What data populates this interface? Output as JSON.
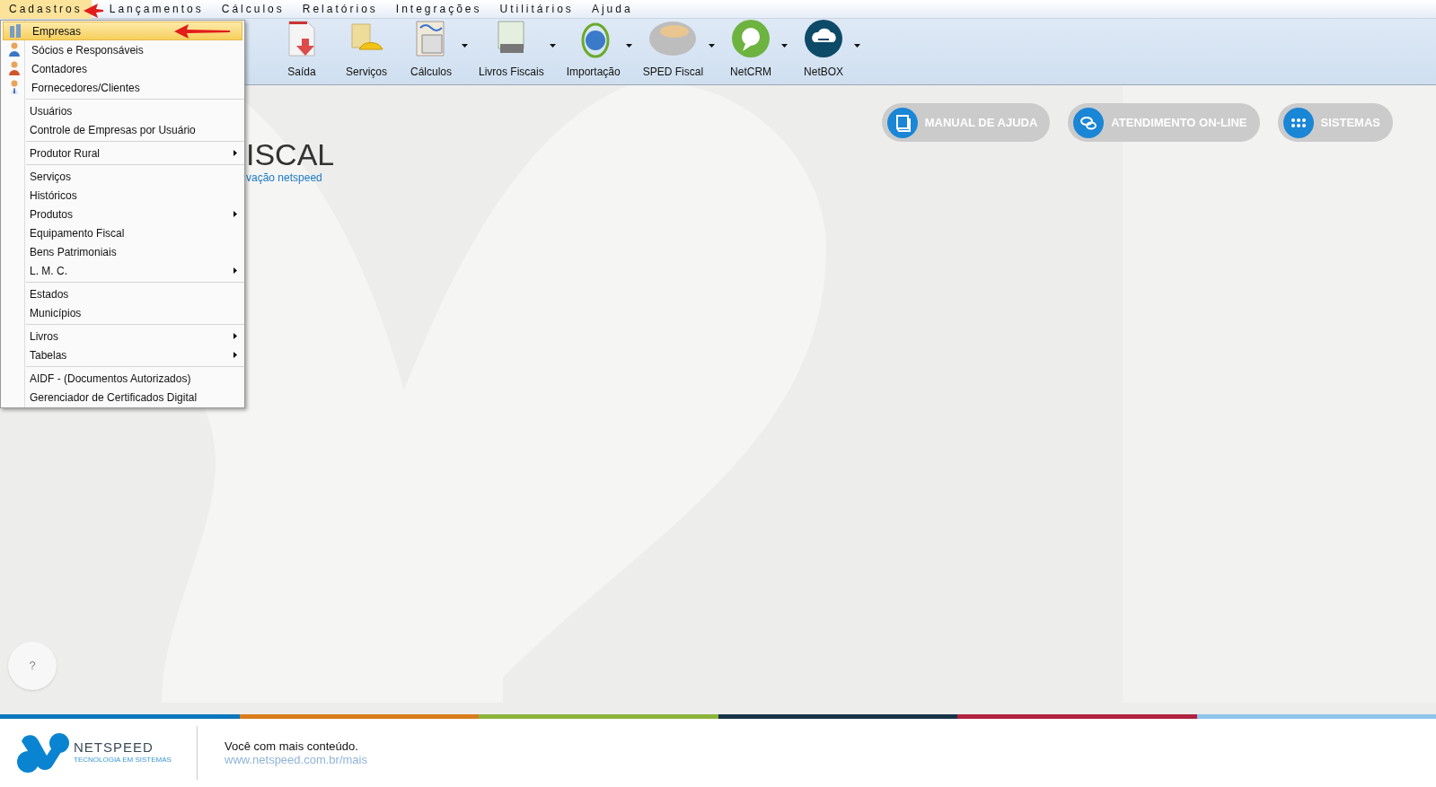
{
  "menubar": [
    {
      "label": "Cadastros",
      "selected": true
    },
    {
      "label": "Lançamentos",
      "selected": false
    },
    {
      "label": "Cálculos",
      "selected": false
    },
    {
      "label": "Relatórios",
      "selected": false
    },
    {
      "label": "Integrações",
      "selected": false
    },
    {
      "label": "Utilitários",
      "selected": false
    },
    {
      "label": "Ajuda",
      "selected": false
    }
  ],
  "toolbar": [
    {
      "label": "Saída",
      "dropdown": false
    },
    {
      "label": "Serviços",
      "dropdown": false
    },
    {
      "label": "Cálculos",
      "dropdown": true
    },
    {
      "label": "Livros Fiscais",
      "dropdown": true
    },
    {
      "label": "Importação",
      "dropdown": true
    },
    {
      "label": "SPED Fiscal",
      "dropdown": true
    },
    {
      "label": "NetCRM",
      "dropdown": true
    },
    {
      "label": "NetBOX",
      "dropdown": true
    }
  ],
  "logo": {
    "title": "ISCAL",
    "subtitle": "vação netspeed"
  },
  "action_buttons": [
    "MANUAL DE AJUDA",
    "ATENDIMENTO ON-LINE",
    "SISTEMAS"
  ],
  "menu": [
    [
      {
        "label": "Empresas",
        "selected": true,
        "submenu": false
      },
      {
        "label": "Sócios e Responsáveis",
        "selected": false,
        "submenu": false
      },
      {
        "label": "Contadores",
        "selected": false,
        "submenu": false
      },
      {
        "label": "Fornecedores/Clientes",
        "selected": false,
        "submenu": false
      }
    ],
    [
      {
        "label": "Usuários",
        "selected": false,
        "submenu": false
      },
      {
        "label": "Controle de Empresas por Usuário",
        "selected": false,
        "submenu": false
      }
    ],
    [
      {
        "label": "Produtor Rural",
        "selected": false,
        "submenu": true
      }
    ],
    [
      {
        "label": "Serviços",
        "selected": false,
        "submenu": false
      },
      {
        "label": "Históricos",
        "selected": false,
        "submenu": false
      },
      {
        "label": "Produtos",
        "selected": false,
        "submenu": true
      },
      {
        "label": "Equipamento Fiscal",
        "selected": false,
        "submenu": false
      },
      {
        "label": "Bens Patrimoniais",
        "selected": false,
        "submenu": false
      },
      {
        "label": "L. M. C.",
        "selected": false,
        "submenu": true
      }
    ],
    [
      {
        "label": "Estados",
        "selected": false,
        "submenu": false
      },
      {
        "label": "Municípios",
        "selected": false,
        "submenu": false
      }
    ],
    [
      {
        "label": "Livros",
        "selected": false,
        "submenu": true
      },
      {
        "label": "Tabelas",
        "selected": false,
        "submenu": true
      }
    ],
    [
      {
        "label": "AIDF - (Documentos Autorizados)",
        "selected": false,
        "submenu": false
      },
      {
        "label": "Gerenciador de Certificados Digital",
        "selected": false,
        "submenu": false
      }
    ]
  ],
  "help_bubble": "?",
  "footer": {
    "brand": "NETSPEED",
    "tagline": "TECNOLOGIA EM SISTEMAS",
    "message": "Você com mais conteúdo.",
    "link": "www.netspeed.com.br/mais"
  }
}
